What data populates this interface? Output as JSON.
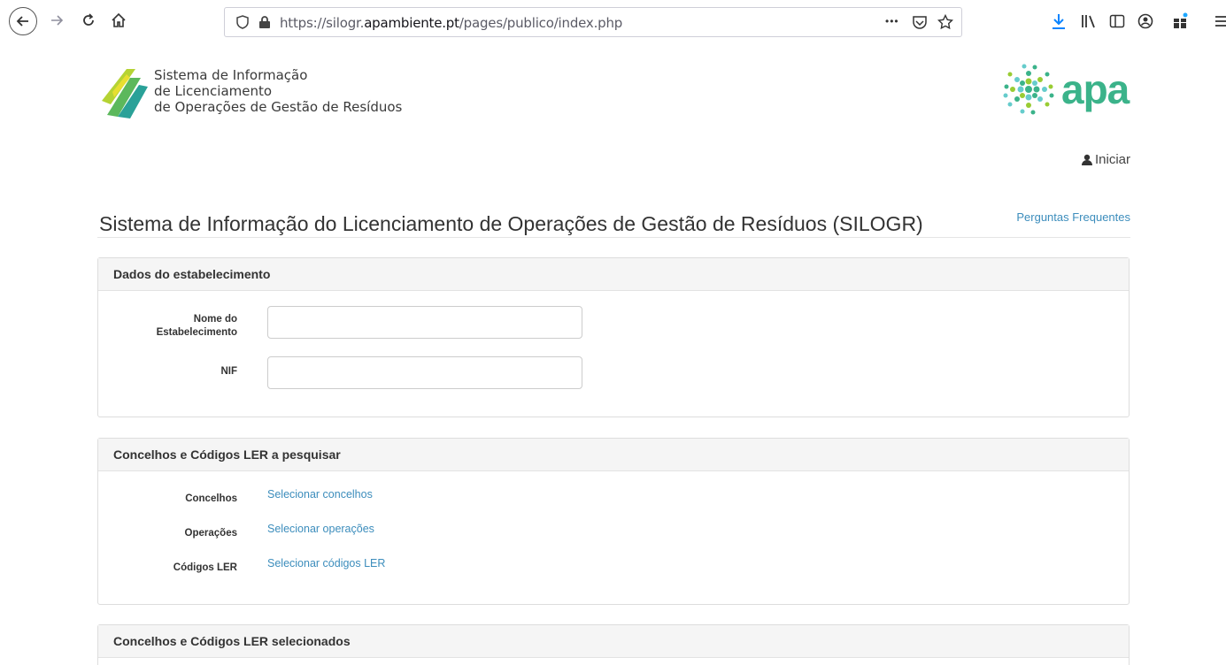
{
  "browser": {
    "url_prefix": "https://silogr.",
    "url_domain": "apambiente.pt",
    "url_path": "/pages/publico/index.php",
    "page_actions": "•••"
  },
  "header": {
    "logo_line1": "Sistema de Informação",
    "logo_line2": "de Licenciamento",
    "logo_line3": "de Operações de Gestão de Resíduos",
    "apa_text": "apa",
    "login_label": "Iniciar"
  },
  "page": {
    "title": "Sistema de Informação do Licenciamento de Operações de Gestão de Resíduos (SILOGR)",
    "faq_link": "Perguntas Frequentes"
  },
  "panel_estabelecimento": {
    "heading": "Dados do estabelecimento",
    "name_label_line1": "Nome do",
    "name_label_line2": "Estabelecimento",
    "name_value": "",
    "nif_label": "NIF",
    "nif_value": ""
  },
  "panel_pesquisar": {
    "heading": "Concelhos e Códigos LER a pesquisar",
    "rows": [
      {
        "label": "Concelhos",
        "link": "Selecionar concelhos"
      },
      {
        "label": "Operações",
        "link": "Selecionar operações"
      },
      {
        "label": "Códigos LER",
        "link": "Selecionar códigos LER"
      }
    ]
  },
  "panel_selecionados": {
    "heading": "Concelhos e Códigos LER selecionados"
  },
  "colors": {
    "link": "#3c8dbc",
    "apa_green": "#3bb38a",
    "download_blue": "#0a84ff"
  }
}
